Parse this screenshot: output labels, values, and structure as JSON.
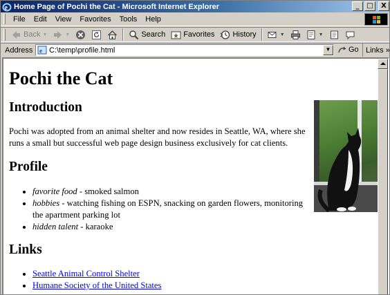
{
  "window": {
    "title": "Home Page of Pochi the Cat - Microsoft Internet Explorer",
    "minimize": "_",
    "maximize": "□",
    "close": "X"
  },
  "menu": [
    "File",
    "Edit",
    "View",
    "Favorites",
    "Tools",
    "Help"
  ],
  "toolbar": {
    "back": "Back",
    "search": "Search",
    "favorites": "Favorites",
    "history": "History"
  },
  "address": {
    "label": "Address",
    "value": "C:\\temp\\profile.html",
    "go": "Go",
    "links": "Links »"
  },
  "page": {
    "title": "Pochi the Cat",
    "sections": {
      "intro_heading": "Introduction",
      "intro_text": "Pochi was adopted from an animal shelter and now resides in Seattle, WA, where she runs a small but successful web page design business exclusively for cat clients.",
      "profile_heading": "Profile",
      "profile_items": [
        {
          "term": "favorite food",
          "desc": " - smoked salmon"
        },
        {
          "term": "hobbies",
          "desc": " - watching fishing on ESPN, snacking on garden flowers, monitoring the apartment parking lot"
        },
        {
          "term": "hidden talent",
          "desc": " - karaoke"
        }
      ],
      "links_heading": "Links",
      "links": [
        "Seattle Animal Control Shelter",
        "Humane Society of the United States"
      ]
    }
  },
  "colors": {
    "titlebar_start": "#0a246a",
    "titlebar_end": "#a6caf0",
    "chrome": "#d4d0c8",
    "link": "#0000ee"
  }
}
